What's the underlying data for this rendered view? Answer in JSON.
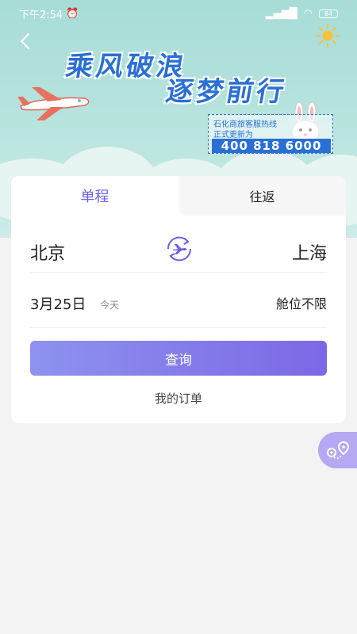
{
  "status_bar": {
    "time": "下午2:54",
    "battery": "84"
  },
  "banner": {
    "slogan_line1": "乘风破浪",
    "slogan_line2": "逐梦前行",
    "notice_line1": "石化商旅客服热线",
    "notice_line2": "正式更新为",
    "hotline": "400 818 6000"
  },
  "tabs": {
    "one_way": "单程",
    "round_trip": "往返"
  },
  "route": {
    "from_city": "北京",
    "to_city": "上海"
  },
  "date": {
    "value": "3月25日",
    "hint": "今天"
  },
  "cabin": "舱位不限",
  "search_button": "查询",
  "my_orders": "我的订单",
  "colors": {
    "accent": "#6b63e0",
    "banner_bg": "#a7dcd7",
    "fab": "#b7a8f3"
  },
  "icons": [
    "back-arrow-icon",
    "sun-icon",
    "plane-illustration",
    "bunny-illustration",
    "swap-route-icon",
    "map-route-icon"
  ]
}
